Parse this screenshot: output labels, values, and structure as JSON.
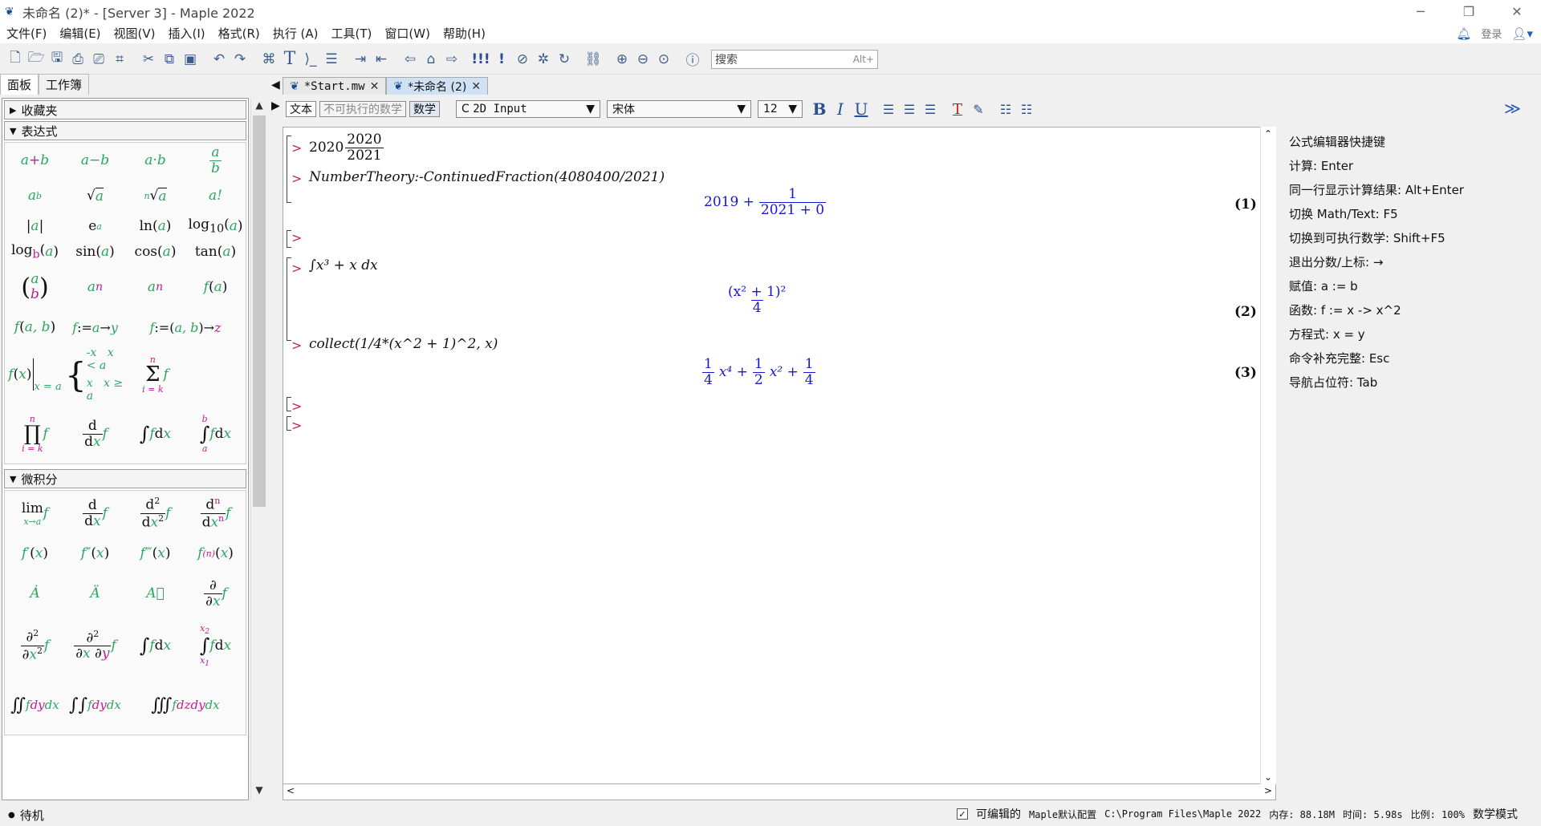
{
  "window": {
    "title": "未命名 (2)* - [Server 3] - Maple 2022",
    "controls": [
      "─",
      "❐",
      "✕"
    ]
  },
  "menu": [
    "文件(F)",
    "编辑(E)",
    "视图(V)",
    "插入(I)",
    "格式(R)",
    "执行 (A)",
    "工具(T)",
    "窗口(W)",
    "帮助(H)"
  ],
  "menu_right": {
    "login": "登录"
  },
  "toolbar": {
    "search_placeholder": "搜索",
    "search_hint": "Alt+"
  },
  "left_tabs": [
    "面板",
    "工作簿"
  ],
  "palette": {
    "favorites": "收藏夹",
    "expression": "表达式",
    "calculus": "微积分",
    "expr_items": [
      "a+b",
      "a−b",
      "a·b",
      "a/b",
      "a^b",
      "√a",
      "ⁿ√a",
      "a!",
      "|a|",
      "e^a",
      "ln(a)",
      "log10(a)",
      "logb(a)",
      "sin(a)",
      "cos(a)",
      "tan(a)",
      "(a b)",
      "a_n",
      "a_n",
      "f(a)",
      "f(a,b)",
      "f:=a→y",
      "f:=(a,b)→z",
      "f(x)|x=a",
      "piecewise",
      "Σ f",
      "Π f",
      "d/dx f",
      "∫ f dx",
      "∫ab f dx"
    ],
    "calc_items": [
      "lim f",
      "d/dx f",
      "d²/dx² f",
      "dⁿ/dxⁿ f",
      "f′(x)",
      "f″(x)",
      "f‴(x)",
      "f⁽ⁿ⁾(x)",
      "Ȧ",
      "Ä",
      "A⃛",
      "∂/∂x f",
      "∂²/∂x² f",
      "∂²/∂x∂y f",
      "∫ f dx",
      "∫x1x2 f dx",
      "∬ f dy dx",
      "∫∫ f dy dx",
      "∭ f dz dy dx"
    ]
  },
  "doc_tabs": [
    {
      "label": "*Start.mw"
    },
    {
      "label": "*未命名  (2)"
    }
  ],
  "format_bar": {
    "text_btn": "文本",
    "nonexec_btn": "不可执行的数学",
    "math_btn": "数学",
    "input_mode": "2D Input",
    "font": "宋体",
    "size": "12"
  },
  "worksheet": {
    "in1": {
      "whole": "2020",
      "num": "2020",
      "den": "2021"
    },
    "in2": "NumberTheory:-ContinuedFraction(4080400/2021)",
    "out1": {
      "whole": "2019 +",
      "num": "1",
      "den": "2021 + 0",
      "label": "(1)"
    },
    "in3": "∫x³ + x dx",
    "out2": {
      "num": "(x² + 1)²",
      "den": "4",
      "label": "(2)"
    },
    "in4": "collect(1/4*(x^2 + 1)^2, x)",
    "out3": {
      "t1n": "1",
      "t1d": "4",
      "t1v": "x⁴ +",
      "t2n": "1",
      "t2d": "2",
      "t2v": "x² +",
      "t3n": "1",
      "t3d": "4",
      "label": "(3)"
    }
  },
  "right_panel": {
    "title": "公式编辑器快捷键",
    "rows": [
      "计算: Enter",
      "同一行显示计算结果: Alt+Enter",
      "切换 Math/Text: F5",
      "切换到可执行数学: Shift+F5",
      "退出分数/上标: →",
      "赋值: a := b",
      "函数: f := x -> x^2",
      "方程式: x = y",
      "命令补充完整: Esc",
      "导航占位符: Tab"
    ]
  },
  "status": {
    "left": "待机",
    "editable": "可编辑的",
    "config": "Maple默认配置",
    "path": "C:\\Program Files\\Maple 2022",
    "memory": "内存: 88.18M",
    "time": "时间: 5.98s",
    "zoom": "比例: 100%",
    "mode": "数学模式"
  }
}
